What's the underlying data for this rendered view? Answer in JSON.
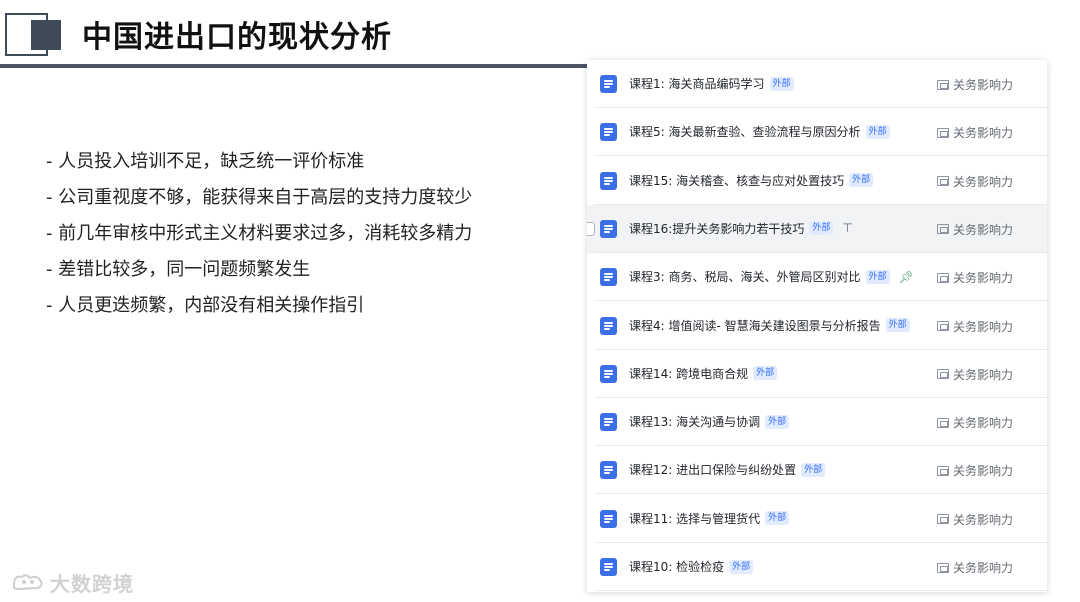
{
  "header": {
    "title": "中国进出口的现状分析"
  },
  "bullets": [
    "- 人员投入培训不足，缺乏统一评价标准",
    "- 公司重视度不够，能获得来自于高层的支持力度较少",
    "-  前几年审核中形式主义材料要求过多，消耗较多精力",
    "-  差错比较多，同一问题频繁发生",
    "- 人员更迭频繁，内部没有相关操作指引"
  ],
  "watermark": {
    "text": "大数跨境"
  },
  "panel": {
    "badge_label": "外部",
    "location_label": "关务影响力",
    "rows": [
      {
        "title": "课程1: 海关商品编码学习"
      },
      {
        "title": "课程5: 海关最新查验、查验流程与原因分析"
      },
      {
        "title": "课程15: 海关稽查、核查与应对处置技巧"
      },
      {
        "title": "课程16:提升关务影响力若干技巧",
        "hover": true,
        "pin": "outline"
      },
      {
        "title": "课程3: 商务、税局、海关、外管局区别对比",
        "pin": "filled"
      },
      {
        "title": "课程4: 增值阅读- 智慧海关建设图景与分析报告"
      },
      {
        "title": "课程14: 跨境电商合规"
      },
      {
        "title": "课程13: 海关沟通与协调"
      },
      {
        "title": "课程12: 进出口保险与纠纷处置"
      },
      {
        "title": "课程11: 选择与管理货代"
      },
      {
        "title": "课程10: 检验检疫"
      }
    ]
  },
  "colors": {
    "accent": "#3a6fe8",
    "badge_bg": "#e1eaff",
    "badge_text": "#3370ff",
    "pin_green": "#3c9a5f",
    "header_block": "#3f4a59"
  }
}
